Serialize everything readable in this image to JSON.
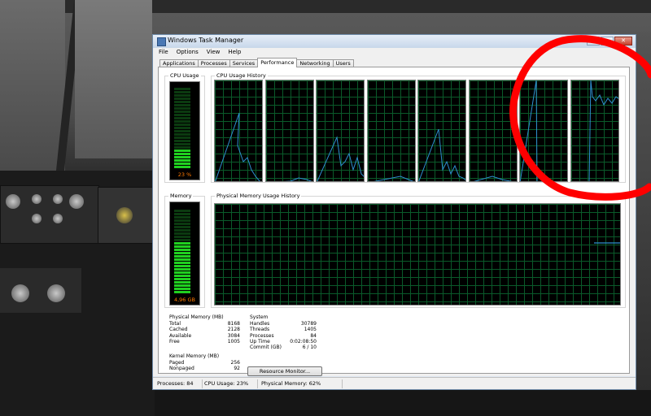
{
  "window": {
    "title": "Windows Task Manager",
    "minimize_glyph": "–",
    "maximize_glyph": "▭",
    "close_glyph": "✕"
  },
  "menu": [
    "File",
    "Options",
    "View",
    "Help"
  ],
  "tabs": [
    "Applications",
    "Processes",
    "Services",
    "Performance",
    "Networking",
    "Users"
  ],
  "active_tab": "Performance",
  "cpu_usage": {
    "label": "CPU Usage",
    "value": "23 %",
    "level": 0.23
  },
  "cpu_history": {
    "label": "CPU Usage History",
    "cores": 8
  },
  "memory": {
    "label": "Memory",
    "value": "4,96 GB",
    "level": 0.62
  },
  "memory_history": {
    "label": "Physical Memory Usage History"
  },
  "physical_memory": {
    "header": "Physical Memory (MB)",
    "rows": [
      {
        "label": "Total",
        "value": "8168"
      },
      {
        "label": "Cached",
        "value": "2128"
      },
      {
        "label": "Available",
        "value": "3084"
      },
      {
        "label": "Free",
        "value": "1005"
      }
    ]
  },
  "kernel_memory": {
    "header": "Kernel Memory (MB)",
    "rows": [
      {
        "label": "Paged",
        "value": "256"
      },
      {
        "label": "Nonpaged",
        "value": "92"
      }
    ]
  },
  "system": {
    "header": "System",
    "rows": [
      {
        "label": "Handles",
        "value": "30789"
      },
      {
        "label": "Threads",
        "value": "1405"
      },
      {
        "label": "Processes",
        "value": "84"
      },
      {
        "label": "Up Time",
        "value": "0:02:08:50"
      },
      {
        "label": "Commit (GB)",
        "value": "6 / 10"
      }
    ]
  },
  "resource_monitor_button": "Resource Monitor...",
  "status": {
    "processes": "Processes: 84",
    "cpu": "CPU Usage: 23%",
    "memory": "Physical Memory: 62%"
  },
  "colors": {
    "graph_line": "#2f8fd0",
    "meter_on": "#20d020",
    "annotation": "#ff0000"
  }
}
